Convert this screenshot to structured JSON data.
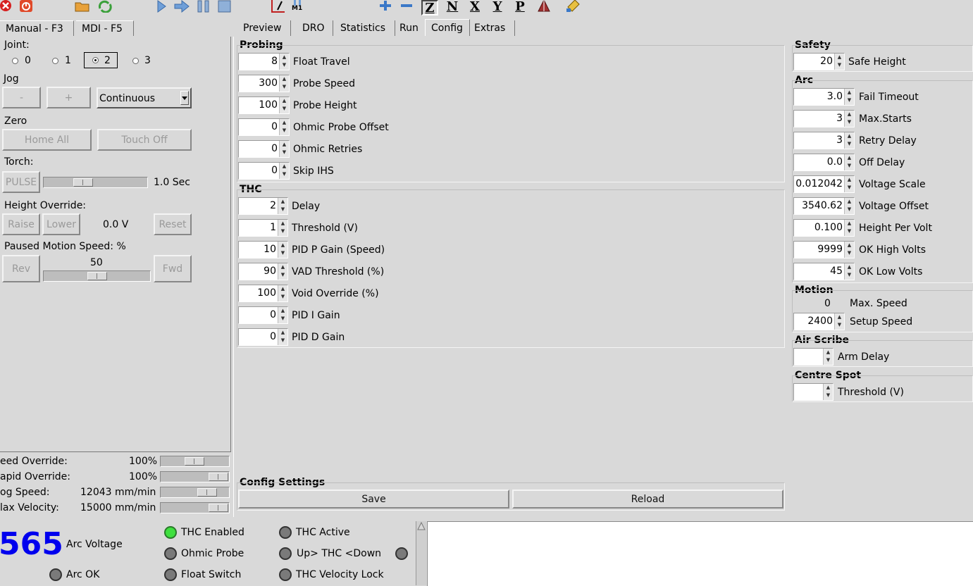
{
  "colors": {
    "background": "#d9d9d9",
    "arc_voltage": "#0000ee",
    "led_on": "#3fe03f",
    "led_off": "#7a7a7a"
  },
  "toolbar": {
    "icons": [
      "close-icon",
      "power-icon",
      "open-folder-icon",
      "reload-icon",
      "run-icon",
      "step-icon",
      "pause-icon",
      "stop-icon",
      "line-edit-icon",
      "m1-icon",
      "zoom-in-icon",
      "zoom-out-icon",
      "view-z-icon",
      "view-n-icon",
      "view-x-icon",
      "view-y-icon",
      "view-p-icon",
      "torch-icon",
      "clear-icon"
    ],
    "view_z": "Z",
    "view_n": "N",
    "view_x": "X",
    "view_y": "Y",
    "view_p": "P",
    "m1": "M1"
  },
  "left_tabs": [
    "Manual - F3",
    "MDI - F5"
  ],
  "manual": {
    "joint_label": "Joint:",
    "joints": [
      "0",
      "1",
      "2",
      "3"
    ],
    "selected_joint": "2",
    "jog_label": "Jog",
    "jog_minus": "-",
    "jog_plus": "+",
    "jog_mode": "Continuous",
    "zero_label": "Zero",
    "home_all": "Home All",
    "touch_off": "Touch Off",
    "torch_label": "Torch:",
    "pulse": "PULSE",
    "pulse_time": "1.0 Sec",
    "pulse_slider_value": 0.35,
    "height_override_label": "Height Override:",
    "raise": "Raise",
    "lower": "Lower",
    "height_value": "0.0 V",
    "reset": "Reset",
    "paused_speed_label": "Paused Motion Speed: %",
    "rev": "Rev",
    "fwd": "Fwd",
    "paused_speed_value": "50",
    "paused_slider_value": 0.5
  },
  "overrides": [
    {
      "label": "eed Override:",
      "value": "100",
      "unit": "%",
      "pos": 0.45
    },
    {
      "label": "apid Override:",
      "value": "100",
      "unit": "%",
      "pos": 0.85
    },
    {
      "label": "og Speed:",
      "value": "12043 mm/min",
      "unit": "",
      "pos": 0.68
    },
    {
      "label": "lax Velocity:",
      "value": "15000 mm/min",
      "unit": "",
      "pos": 0.85
    }
  ],
  "status": {
    "arc_voltage_value": "565",
    "arc_voltage_label": "Arc Voltage",
    "arc_ok": "Arc OK",
    "thc_enabled": "THC Enabled",
    "ohmic_probe": "Ohmic Probe",
    "float_switch": "Float Switch",
    "thc_active": "THC Active",
    "up_down": "Up> THC <Down",
    "thc_velocity_lock": "THC Velocity Lock"
  },
  "right_tabs": [
    "Preview",
    "DRO",
    "Statistics",
    "Run",
    "Config",
    "Extras"
  ],
  "active_right_tab": "Config",
  "config": {
    "probing_label": "Probing",
    "probing": [
      {
        "value": "8",
        "label": "Float Travel"
      },
      {
        "value": "300",
        "label": "Probe Speed"
      },
      {
        "value": "100",
        "label": "Probe Height"
      },
      {
        "value": "0",
        "label": "Ohmic Probe Offset"
      },
      {
        "value": "0",
        "label": "Ohmic Retries"
      },
      {
        "value": "0",
        "label": "Skip IHS"
      }
    ],
    "thc_label": "THC",
    "thc": [
      {
        "value": "2",
        "label": "Delay"
      },
      {
        "value": "1",
        "label": "Threshold (V)"
      },
      {
        "value": "10",
        "label": "PID P Gain (Speed)"
      },
      {
        "value": "90",
        "label": "VAD Threshold (%)"
      },
      {
        "value": "100",
        "label": "Void Override (%)"
      },
      {
        "value": "0",
        "label": "PID I Gain"
      },
      {
        "value": "0",
        "label": "PID D Gain"
      }
    ],
    "settings_label": "Config Settings",
    "save": "Save",
    "reload": "Reload",
    "safety_label": "Safety",
    "safety": [
      {
        "value": "20",
        "label": "Safe Height"
      }
    ],
    "arc_label": "Arc",
    "arc": [
      {
        "value": "3.0",
        "label": "Fail Timeout"
      },
      {
        "value": "3",
        "label": "Max.Starts"
      },
      {
        "value": "3",
        "label": "Retry Delay"
      },
      {
        "value": "0.0",
        "label": "Off Delay"
      },
      {
        "value": "0.012042",
        "label": "Voltage Scale"
      },
      {
        "value": "3540.62",
        "label": "Voltage Offset"
      },
      {
        "value": "0.100",
        "label": "Height Per Volt"
      },
      {
        "value": "9999",
        "label": "OK High Volts"
      },
      {
        "value": "45",
        "label": "OK Low Volts"
      }
    ],
    "motion_label": "Motion",
    "max_speed_value": "0",
    "max_speed_label": "Max. Speed",
    "setup_speed": {
      "value": "2400",
      "label": "Setup Speed"
    },
    "air_scribe_label": "Air Scribe",
    "arm_delay": {
      "value": "",
      "label": "Arm Delay"
    },
    "centre_spot_label": "Centre Spot",
    "centre_threshold": {
      "value": "",
      "label": "Threshold (V)"
    }
  }
}
